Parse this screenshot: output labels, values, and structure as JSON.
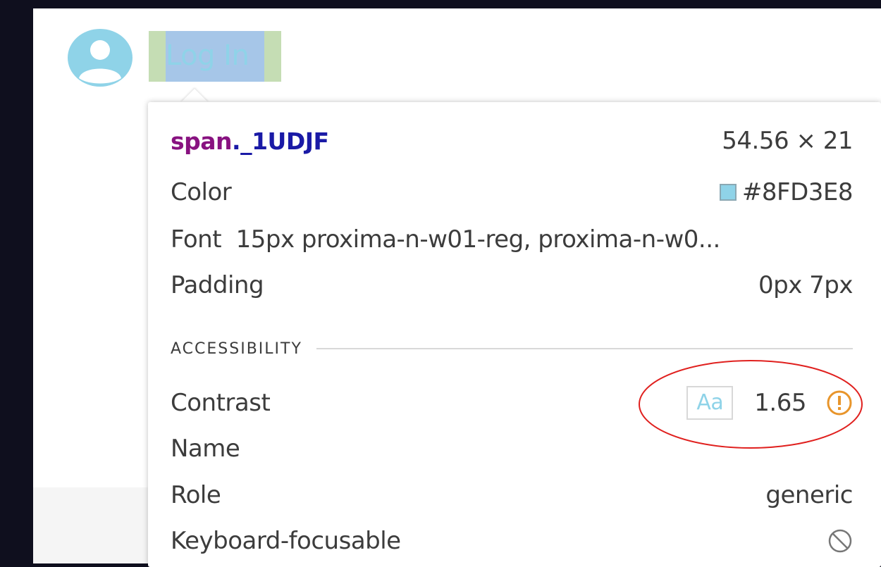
{
  "page": {
    "login_label": "Log In"
  },
  "tooltip": {
    "selector_tag": "span",
    "selector_class": "._1UDJF",
    "dimensions": "54.56 × 21",
    "color_label": "Color",
    "color_value": "#8FD3E8",
    "font_label": "Font",
    "font_value": "15px proxima-n-w01-reg, proxima-n-w0...",
    "padding_label": "Padding",
    "padding_value": "0px 7px",
    "section_title": "ACCESSIBILITY",
    "contrast_label": "Contrast",
    "contrast_sample": "Aa",
    "contrast_value": "1.65",
    "name_label": "Name",
    "role_label": "Role",
    "role_value": "generic",
    "focusable_label": "Keyboard-focusable"
  },
  "icons": {
    "avatar": "user-avatar-icon",
    "warning": "warning-circle-icon",
    "not_focusable": "no-entry-icon"
  },
  "colors": {
    "link_color": "#8FD3E8",
    "warning": "#E8952B",
    "annotation_circle": "#E0201E",
    "background_dark": "#0f0f1e"
  }
}
